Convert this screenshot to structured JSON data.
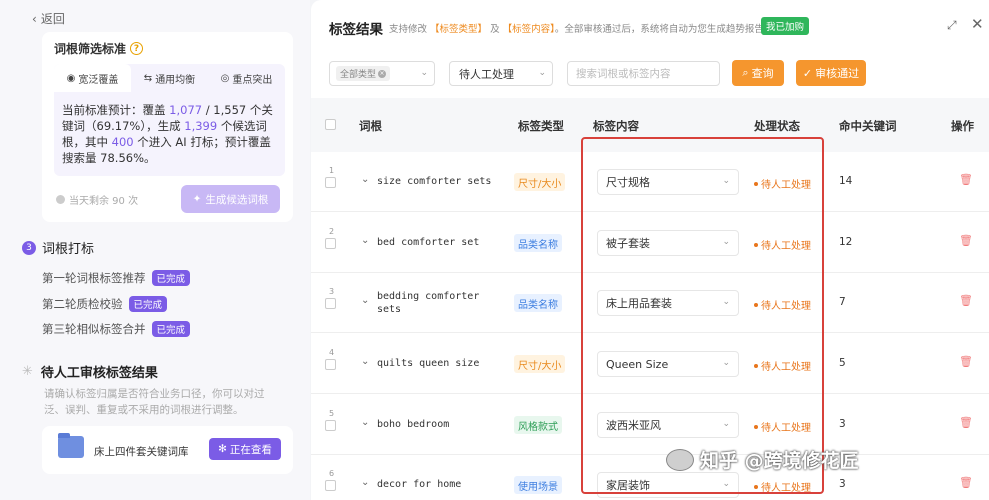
{
  "left": {
    "back_label": "返回",
    "card_title": "词根筛选标准",
    "strategy_tabs": [
      {
        "icon": "broad-coverage-icon",
        "label": "宽泛覆盖"
      },
      {
        "icon": "balance-icon",
        "label": "通用均衡"
      },
      {
        "icon": "focus-icon",
        "label": "重点突出"
      }
    ],
    "estimate": {
      "p1": "当前标准预计：覆盖 ",
      "covered": "1,077",
      "p2": " / 1,557 个关键词（69.17%），生成 ",
      "generated": "1,399",
      "p3": " 个候选词根，其中 ",
      "ai": "400",
      "p4": " 个进入 AI 打标；预计覆盖搜索量 78.56%。"
    },
    "remaining": "当天剩余 90 次",
    "generate_button": "生成候选词根",
    "step3": {
      "num": "3",
      "title": "词根打标",
      "substeps": [
        {
          "label": "第一轮词根标签推荐",
          "badge": "已完成"
        },
        {
          "label": "第二轮质检校验",
          "badge": "已完成"
        },
        {
          "label": "第三轮相似标签合并",
          "badge": "已完成"
        }
      ]
    },
    "step4": {
      "title": "待人工审核标签结果",
      "desc": "请确认标签归属是否符合业务口径，你可以对过泛、误判、重复或不采用的词根进行调整。"
    },
    "library": {
      "name": "床上四件套关键词库",
      "button": "正在查看"
    }
  },
  "right": {
    "title": "标签结果",
    "hint": {
      "p1": "支持修改",
      "t1": "【标签类型】",
      "p2": "及",
      "t2": "【标签内容】",
      "p3": "。全部审核通过后，系统将自动为您生成趋势报告。"
    },
    "joined_badge": "我已加购",
    "filters": {
      "type_chip": "全部类型",
      "status_value": "待人工处理",
      "search_placeholder": "搜索词根或标签内容",
      "query_button": "查询",
      "approve_button": "审核通过"
    },
    "columns": {
      "root": "词根",
      "type": "标签类型",
      "content": "标签内容",
      "status": "处理状态",
      "hits": "命中关键词",
      "ops": "操作"
    },
    "rows": [
      {
        "idx": "1",
        "word": "size comforter sets",
        "type": "尺寸/大小",
        "type_style": "orange",
        "content": "尺寸规格",
        "status": "待人工处理",
        "hits": "14"
      },
      {
        "idx": "2",
        "word": "bed comforter set",
        "type": "品类名称",
        "type_style": "blue",
        "content": "被子套装",
        "status": "待人工处理",
        "hits": "12"
      },
      {
        "idx": "3",
        "word": "bedding comforter sets",
        "type": "品类名称",
        "type_style": "blue",
        "content": "床上用品套装",
        "status": "待人工处理",
        "hits": "7"
      },
      {
        "idx": "4",
        "word": "quilts queen size",
        "type": "尺寸/大小",
        "type_style": "orange",
        "content": "Queen Size",
        "status": "待人工处理",
        "hits": "5"
      },
      {
        "idx": "5",
        "word": "boho bedroom",
        "type": "风格款式",
        "type_style": "green",
        "content": "波西米亚风",
        "status": "待人工处理",
        "hits": "3"
      },
      {
        "idx": "6",
        "word": "decor for home",
        "type": "使用场景",
        "type_style": "blue",
        "content": "家居装饰",
        "status": "待人工处理",
        "hits": "3"
      }
    ]
  },
  "watermark": "知乎 @跨境修花匠",
  "colors": {
    "accent": "#7b5ce6",
    "orange": "#f5962e",
    "status": "#e8751b",
    "highlight_box": "#d8413b"
  }
}
